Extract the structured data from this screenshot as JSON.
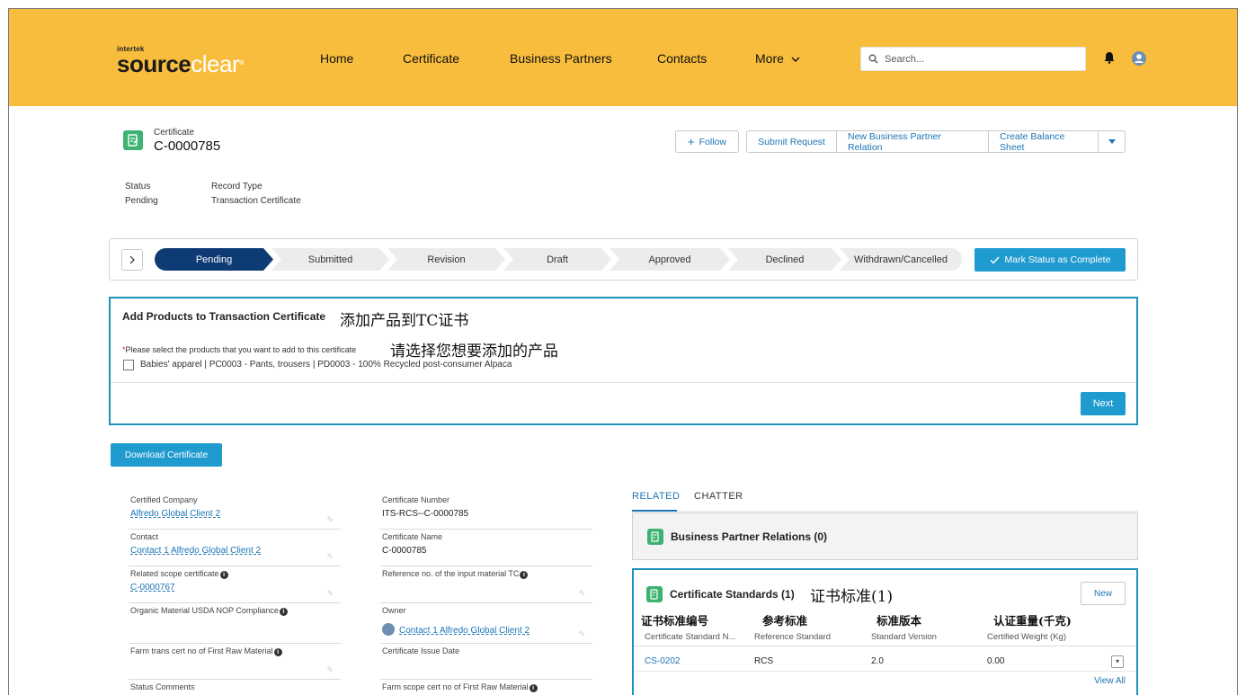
{
  "brand": {
    "small": "intertek",
    "main_a": "source",
    "main_b": "clear",
    "tm": "®"
  },
  "nav": {
    "home": "Home",
    "certificate": "Certificate",
    "business_partners": "Business Partners",
    "contacts": "Contacts",
    "more": "More"
  },
  "search": {
    "placeholder": "Search..."
  },
  "record": {
    "object": "Certificate",
    "title": "C-0000785",
    "status_label": "Status",
    "status_value": "Pending",
    "record_type_label": "Record Type",
    "record_type_value": "Transaction Certificate"
  },
  "actions": {
    "follow": "Follow",
    "submit": "Submit Request",
    "new_bpr": "New Business Partner Relation",
    "balance": "Create Balance Sheet"
  },
  "path": {
    "steps": [
      "Pending",
      "Submitted",
      "Revision",
      "Draft",
      "Approved",
      "Declined",
      "Withdrawn/Cancelled"
    ],
    "current": "Pending",
    "mark_button": "Mark Status as Complete"
  },
  "add_products": {
    "title": "Add Products to Transaction Certificate",
    "title_cn": "添加产品到TC证书",
    "required_mark": "*",
    "required_text": "Please select the products that you want to add to this certificate",
    "required_cn": "请选择您想要添加的产品",
    "option": "Babies' apparel | PC0003 - Pants, trousers | PD0003 - 100% Recycled post-consumer Alpaca",
    "next": "Next"
  },
  "download_button": "Download Certificate",
  "details": {
    "left": [
      {
        "label": "Certified Company",
        "value": "Alfredo Global Client 2"
      },
      {
        "label": "Contact",
        "value": "Contact 1 Alfredo Global Client 2"
      },
      {
        "label": "Related scope certificate",
        "value": "C-0000767"
      },
      {
        "label": "Organic Material USDA NOP Compliance",
        "value": ""
      },
      {
        "label": "Farm trans cert no of First Raw Material",
        "value": ""
      },
      {
        "label": "Status Comments",
        "value": ""
      }
    ],
    "right": [
      {
        "label": "Certificate Number",
        "value": "ITS-RCS--C-0000785"
      },
      {
        "label": "Certificate Name",
        "value": "C-0000785"
      },
      {
        "label": "Reference no. of the input material TC",
        "value": ""
      },
      {
        "label": "Owner",
        "value": "Contact 1 Alfredo Global Client 2"
      },
      {
        "label": "Certificate Issue Date",
        "value": ""
      },
      {
        "label": "Farm scope cert no of First Raw Material",
        "value": ""
      }
    ]
  },
  "related": {
    "tabs": [
      "RELATED",
      "CHATTER"
    ],
    "bpr_title": "Business Partner Relations (0)",
    "cs_title": "Certificate Standards (1)",
    "cs_title_cn": "证书标准(1)",
    "new": "New",
    "columns": [
      "Certificate Standard N...",
      "Reference Standard",
      "Standard Version",
      "Certified Weight (Kg)"
    ],
    "columns_cn": [
      "证书标准编号",
      "参考标准",
      "标准版本",
      "认证重量(千克)"
    ],
    "row": [
      "CS-0202",
      "RCS",
      "2.0",
      "0.00"
    ],
    "view_all": "View All"
  },
  "colors": {
    "header": "#f8bd3c",
    "accent": "#1f9bcf",
    "active_step": "#0e3b73",
    "object_icon": "#3cb371",
    "link": "#1b74b4"
  }
}
